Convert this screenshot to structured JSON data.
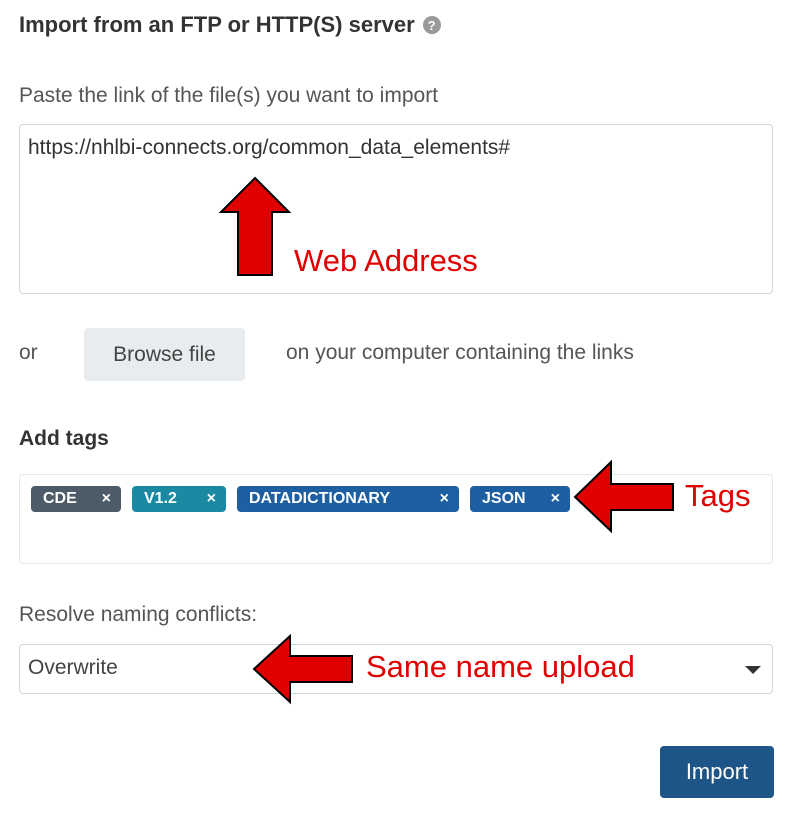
{
  "header": {
    "title": "Import from an FTP or HTTP(S) server",
    "help_icon": "question-circle-icon"
  },
  "url_field": {
    "label": "Paste the link of the file(s) you want to import",
    "value": "https://nhlbi-connects.org/common_data_elements#"
  },
  "browse": {
    "or_text": "or",
    "button_label": "Browse file",
    "suffix_text": "on your computer containing the links"
  },
  "tags": {
    "title": "Add tags",
    "items": [
      {
        "label": "CDE",
        "color": "#4d5b69"
      },
      {
        "label": "V1.2",
        "color": "#1a8aa3"
      },
      {
        "label": "DATADICTIONARY",
        "color": "#1d5fa0"
      },
      {
        "label": "JSON",
        "color": "#1d5fa0"
      }
    ],
    "remove_glyph": "×"
  },
  "conflicts": {
    "label": "Resolve naming conflicts:",
    "selected": "Overwrite"
  },
  "actions": {
    "import_label": "Import"
  },
  "annotations": {
    "web_address": "Web Address",
    "tags": "Tags",
    "same_name": "Same name upload",
    "arrow_color": "#e00000"
  }
}
